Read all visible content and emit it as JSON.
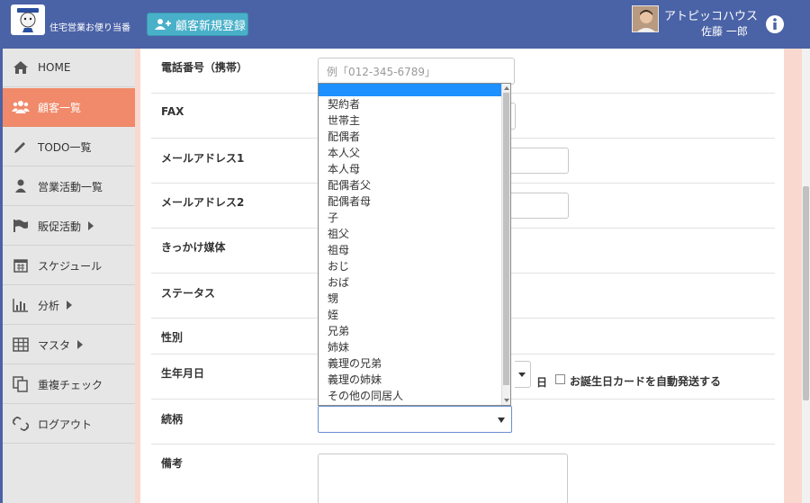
{
  "header": {
    "app_title": "住宅営業お便り当番",
    "new_customer_button": "顧客新規登録",
    "company": "アトピッコハウス",
    "user": "佐藤 一郎"
  },
  "sidebar": {
    "items": [
      {
        "label": "HOME",
        "icon": "home-icon"
      },
      {
        "label": "顧客一覧",
        "icon": "users-icon",
        "active": true
      },
      {
        "label": "TODO一覧",
        "icon": "pencil-icon"
      },
      {
        "label": "営業活動一覧",
        "icon": "user-icon"
      },
      {
        "label": "販促活動",
        "icon": "flag-icon",
        "submenu": true
      },
      {
        "label": "スケジュール",
        "icon": "calendar-icon"
      },
      {
        "label": "分析",
        "icon": "bar-chart-icon",
        "submenu": true
      },
      {
        "label": "マスタ",
        "icon": "table-icon",
        "submenu": true
      },
      {
        "label": "重複チェック",
        "icon": "copy-icon"
      },
      {
        "label": "ログアウト",
        "icon": "unlink-icon"
      }
    ]
  },
  "form": {
    "labels": {
      "mobile": "電話番号（携帯）",
      "fax": "FAX",
      "email1": "メールアドレス1",
      "email2": "メールアドレス2",
      "trigger": "きっかけ媒体",
      "status": "ステータス",
      "gender": "性別",
      "birthday": "生年月日",
      "relation": "続柄",
      "notes": "備考"
    },
    "mobile_placeholder": "例「012-345-6789」",
    "day_label": "日",
    "birthday_card_label": "お誕生日カードを自動発送する",
    "relation_value": ""
  },
  "relation_options": [
    "",
    "契約者",
    "世帯主",
    "配偶者",
    "本人父",
    "本人母",
    "配偶者父",
    "配偶者母",
    "子",
    "祖父",
    "祖母",
    "おじ",
    "おば",
    "甥",
    "姪",
    "兄弟",
    "姉妹",
    "義理の兄弟",
    "義理の姉妹",
    "その他の同居人"
  ],
  "colors": {
    "header": "#4a62a6",
    "active_nav": "#f08a6a",
    "primary_button": "#49b0c9",
    "highlight": "#1e90ff",
    "side_panel": "#f9d9cf"
  }
}
